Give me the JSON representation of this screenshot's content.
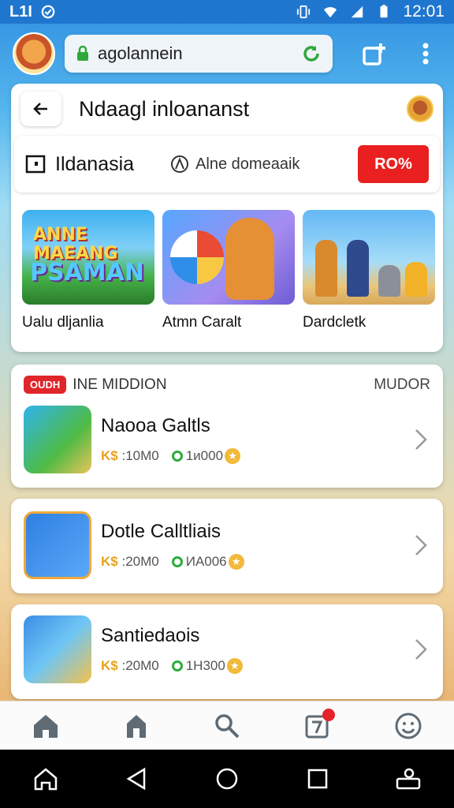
{
  "status": {
    "carrier": "L1I",
    "time": "12:01"
  },
  "browser": {
    "url": "agolannein"
  },
  "page": {
    "title": "Ndaagl inloananst"
  },
  "tabs": {
    "primary_label": "Ildanasia",
    "secondary_label": "Alne domeaaik",
    "promo_label": "RO%"
  },
  "games": [
    {
      "label": "Ualu dljanlia",
      "thumb_text_1": "ANNE MAEANG",
      "thumb_text_2": "PSAMAN"
    },
    {
      "label": "Atmn Caralt"
    },
    {
      "label": "Dardcletk"
    }
  ],
  "list": {
    "badge": "OUDH",
    "title": "INE MIDDION",
    "more": "MUDOR",
    "items": [
      {
        "name": "Naooa Galtls",
        "price_prefix": "K$",
        "price": ":10M0",
        "plays": "1и000"
      },
      {
        "name": "Dotle Calltliais",
        "price_prefix": "K$",
        "price": ":20M0",
        "plays": "ИA006"
      },
      {
        "name": "Santiedaois",
        "price_prefix": "K$",
        "price": ":20M0",
        "plays": "1H300"
      }
    ]
  },
  "nav": {
    "badge_count": ""
  },
  "colors": {
    "accent": "#1f76cf",
    "promo": "#ea1f1f",
    "badge": "#e0262a"
  }
}
